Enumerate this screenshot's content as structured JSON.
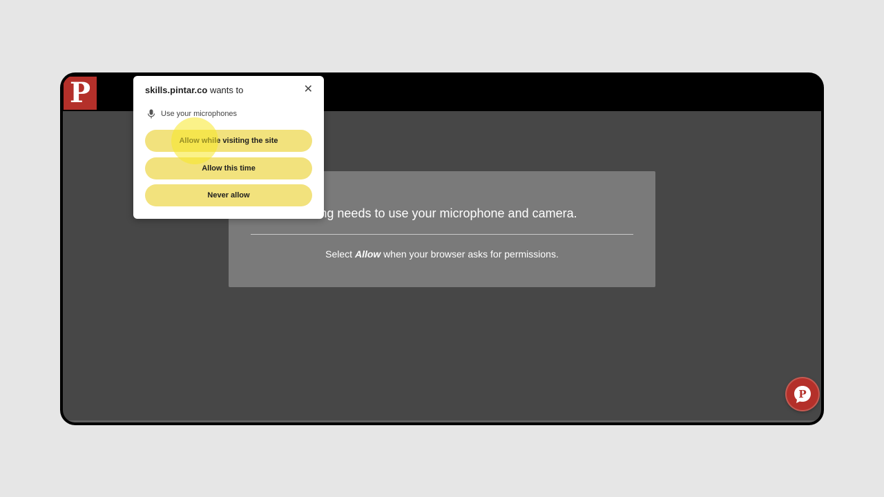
{
  "app": {
    "logo_letter": "P",
    "brand_color": "#b4302a"
  },
  "notice": {
    "heading": "eting needs to use your microphone and camera.",
    "instruction_before": "Select ",
    "instruction_emph": "Allow",
    "instruction_after": " when your browser asks for permissions."
  },
  "chat_button": {
    "icon": "chat-logo-icon",
    "letter": "P"
  },
  "permission_popup": {
    "site": "skills.pintar.co",
    "wants_to": " wants to",
    "close_symbol": "✕",
    "permission_icon": "microphone-icon",
    "permission_label": "Use your microphones",
    "buttons": [
      {
        "label": "Allow while visiting the site"
      },
      {
        "label": "Allow this time"
      },
      {
        "label": "Never allow"
      }
    ],
    "button_color": "#f2e27d"
  }
}
